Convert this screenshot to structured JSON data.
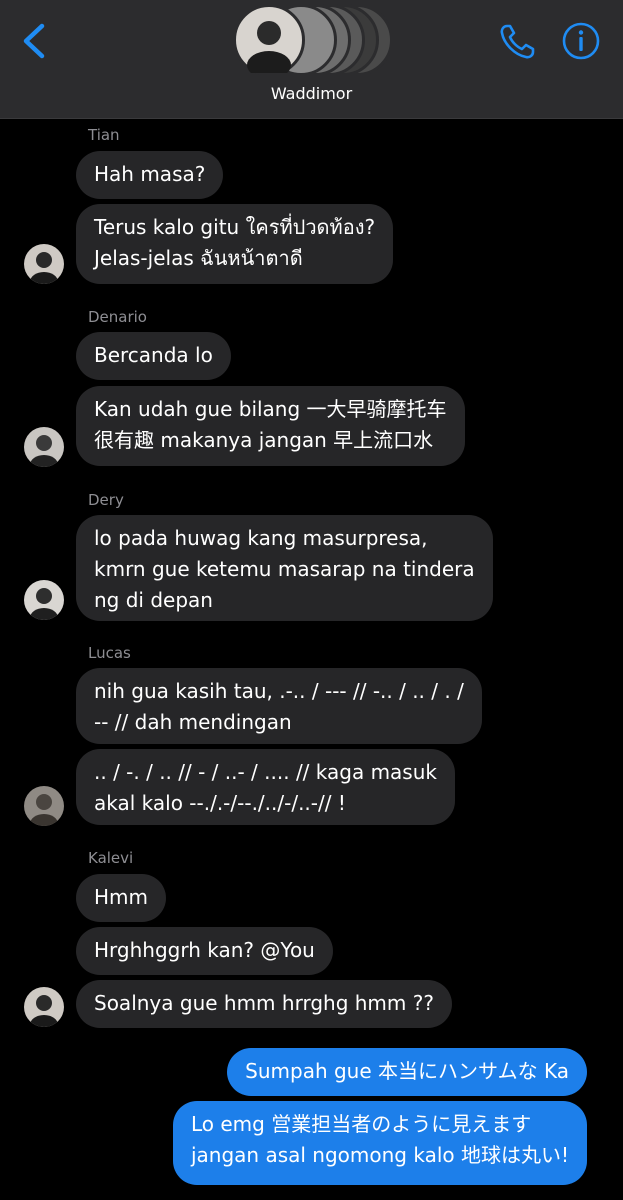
{
  "header": {
    "group_name": "Waddimor",
    "icons": {
      "back": "chevron-left-icon",
      "call": "phone-icon",
      "info": "info-icon"
    },
    "accent": "#1f8cf3"
  },
  "messages": [
    {
      "sender": "Tian",
      "bubbles": [
        {
          "lines": [
            "Hah masa?"
          ]
        },
        {
          "lines": [
            "Terus kalo gitu ใครที่ปวดท้อง?",
            "Jelas-jelas ฉันหน้าตาดี"
          ]
        }
      ]
    },
    {
      "sender": "Denario",
      "bubbles": [
        {
          "lines": [
            "Bercanda lo"
          ]
        },
        {
          "lines": [
            "Kan udah gue bilang 一大早骑摩托车",
            "很有趣 makanya jangan 早上流口水"
          ]
        }
      ]
    },
    {
      "sender": "Dery",
      "bubbles": [
        {
          "lines": [
            "lo pada huwag kang masurpresa,",
            "kmrn gue ketemu masarap na tindera",
            "ng di depan"
          ]
        }
      ]
    },
    {
      "sender": "Lucas",
      "bubbles": [
        {
          "lines": [
            "nih gua kasih tau, .-.. / --- // -.. / .. / . /",
            "-- // dah mendingan"
          ]
        },
        {
          "lines": [
            ".. / -. / .. // - / ..- / .... // kaga masuk",
            "akal kalo --./.-/--./../-/..-// !"
          ]
        }
      ]
    },
    {
      "sender": "Kalevi",
      "bubbles": [
        {
          "lines": [
            "Hmm"
          ]
        },
        {
          "lines": [
            "Hrghhggrh kan? @You"
          ]
        },
        {
          "lines": [
            "Soalnya gue hmm hrrghg hmm ??"
          ]
        }
      ]
    }
  ],
  "outgoing": [
    {
      "lines": [
        "Sumpah gue 本当にハンサムな Ka"
      ]
    },
    {
      "lines": [
        "Lo emg 営業担当者のように見えます",
        "jangan asal ngomong kalo 地球は丸い!"
      ]
    }
  ],
  "colors": {
    "incoming_bubble": "#262628",
    "outgoing_bubble": "#1d7fea",
    "sender_label": "#8e8e93"
  }
}
